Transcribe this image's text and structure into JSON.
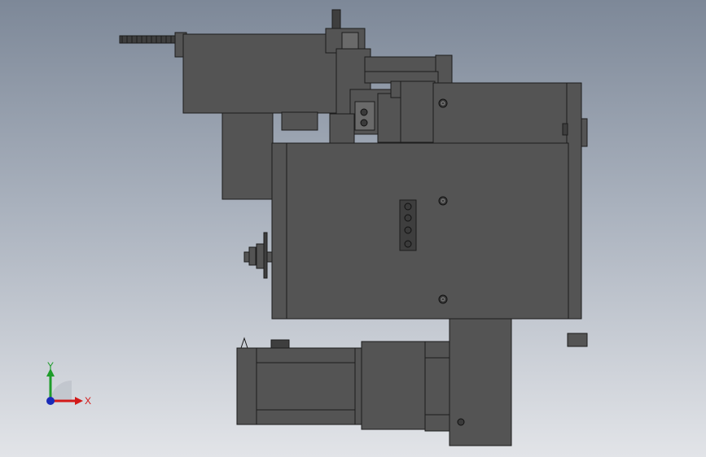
{
  "viewport": {
    "background_top": "#7d8898",
    "background_bottom": "#e2e4e8",
    "model_fill": "#545454",
    "model_stroke": "#1c1c1c",
    "model_highlight": "#6a6a6a"
  },
  "triad": {
    "x_label": "X",
    "y_label": "Y",
    "x_color": "#d21a1a",
    "y_color": "#1e9c2a",
    "z_color": "#1a2bb8"
  }
}
